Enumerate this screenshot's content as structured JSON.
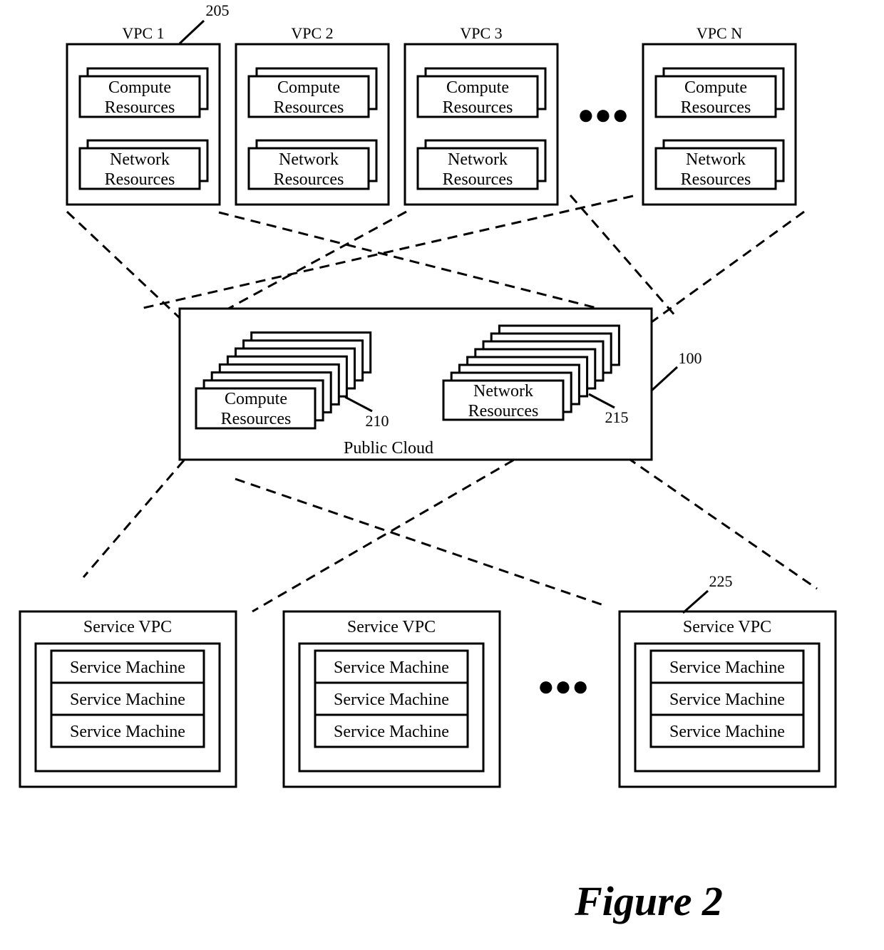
{
  "figure": {
    "caption": "Figure 2"
  },
  "tenant_vpcs": {
    "reference": "205",
    "ellipsis": "●●●",
    "items": [
      {
        "name": "VPC 1",
        "compute_label_1": "Compute",
        "compute_label_2": "Resources",
        "network_label_1": "Network",
        "network_label_2": "Resources"
      },
      {
        "name": "VPC 2",
        "compute_label_1": "Compute",
        "compute_label_2": "Resources",
        "network_label_1": "Network",
        "network_label_2": "Resources"
      },
      {
        "name": "VPC 3",
        "compute_label_1": "Compute",
        "compute_label_2": "Resources",
        "network_label_1": "Network",
        "network_label_2": "Resources"
      },
      {
        "name": "VPC N",
        "compute_label_1": "Compute",
        "compute_label_2": "Resources",
        "network_label_1": "Network",
        "network_label_2": "Resources"
      }
    ]
  },
  "public_cloud": {
    "label": "Public Cloud",
    "reference": "100",
    "compute": {
      "label_1": "Compute",
      "label_2": "Resources",
      "reference": "210",
      "stack_count": 8
    },
    "network": {
      "label_1": "Network",
      "label_2": "Resources",
      "reference": "215",
      "stack_count": 8
    }
  },
  "service_vpcs": {
    "reference": "225",
    "ellipsis": "●●●",
    "items": [
      {
        "name": "Service VPC",
        "machines": [
          "Service Machine",
          "Service Machine",
          "Service Machine"
        ]
      },
      {
        "name": "Service VPC",
        "machines": [
          "Service Machine",
          "Service Machine",
          "Service Machine"
        ]
      },
      {
        "name": "Service VPC",
        "machines": [
          "Service Machine",
          "Service Machine",
          "Service Machine"
        ]
      }
    ]
  }
}
